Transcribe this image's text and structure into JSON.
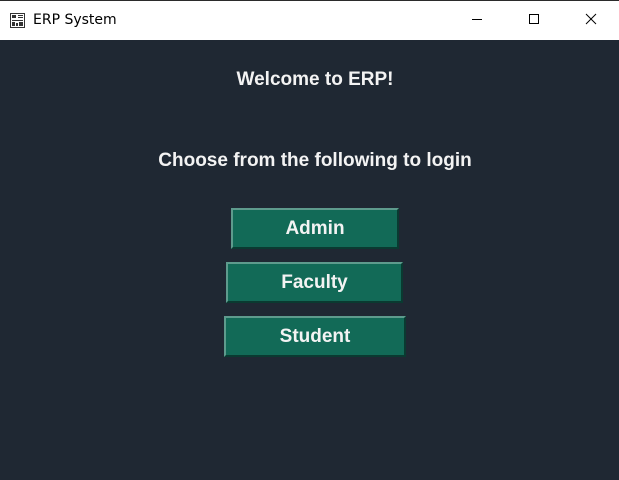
{
  "window": {
    "title": "ERP System",
    "app_icon": "erp-app-icon",
    "controls": {
      "minimize_icon": "minimize-icon",
      "maximize_icon": "maximize-icon",
      "close_icon": "close-icon"
    }
  },
  "main": {
    "welcome_text": "Welcome to ERP!",
    "instruction_text": "Choose from the following to login",
    "buttons": {
      "admin_label": "Admin",
      "faculty_label": "Faculty",
      "student_label": "Student"
    }
  },
  "colors": {
    "background": "#1f2833",
    "button": "#126a57",
    "text": "#f3f3f3",
    "titlebar": "#ffffff"
  }
}
